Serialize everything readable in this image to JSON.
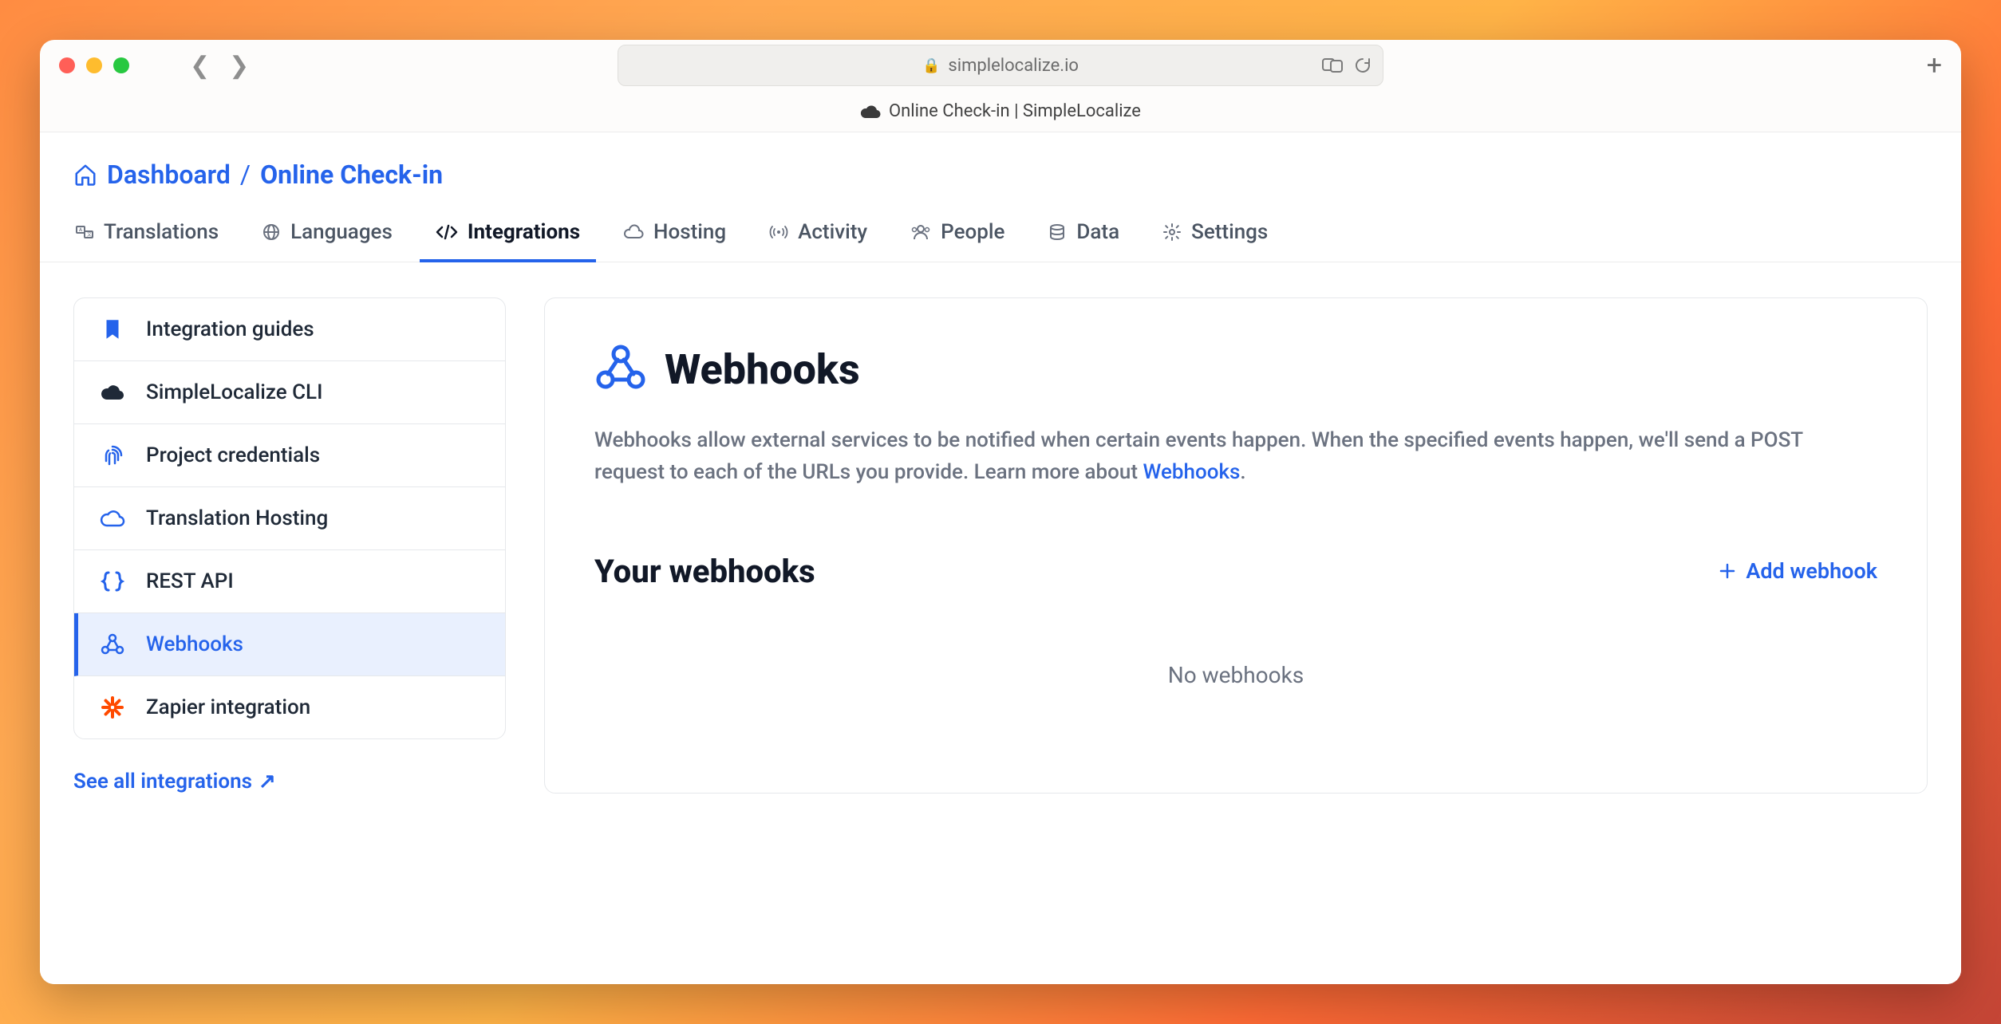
{
  "browser": {
    "url": "simplelocalize.io",
    "tab_title": "Online Check-in | SimpleLocalize"
  },
  "breadcrumb": {
    "root": "Dashboard",
    "current": "Online Check-in"
  },
  "tabs": [
    {
      "label": "Translations",
      "icon": "translate-icon"
    },
    {
      "label": "Languages",
      "icon": "globe-icon"
    },
    {
      "label": "Integrations",
      "icon": "code-icon"
    },
    {
      "label": "Hosting",
      "icon": "cloud-icon"
    },
    {
      "label": "Activity",
      "icon": "signal-icon"
    },
    {
      "label": "People",
      "icon": "people-icon"
    },
    {
      "label": "Data",
      "icon": "database-icon"
    },
    {
      "label": "Settings",
      "icon": "gear-icon"
    }
  ],
  "active_tab_index": 2,
  "sidebar": {
    "items": [
      {
        "label": "Integration guides",
        "icon": "bookmark-icon"
      },
      {
        "label": "SimpleLocalize CLI",
        "icon": "cloud-solid-icon"
      },
      {
        "label": "Project credentials",
        "icon": "fingerprint-icon"
      },
      {
        "label": "Translation Hosting",
        "icon": "cloud-outline-icon"
      },
      {
        "label": "REST API",
        "icon": "braces-icon"
      },
      {
        "label": "Webhooks",
        "icon": "webhook-icon"
      },
      {
        "label": "Zapier integration",
        "icon": "zapier-icon"
      }
    ],
    "active_index": 5,
    "see_all": "See all integrations"
  },
  "main": {
    "title": "Webhooks",
    "description_pre": "Webhooks allow external services to be notified when certain events happen. When the specified events happen, we'll send a POST request to each of the URLs you provide. Learn more about ",
    "description_link": "Webhooks",
    "description_post": ".",
    "section_title": "Your webhooks",
    "add_button": "Add webhook",
    "empty": "No webhooks"
  }
}
